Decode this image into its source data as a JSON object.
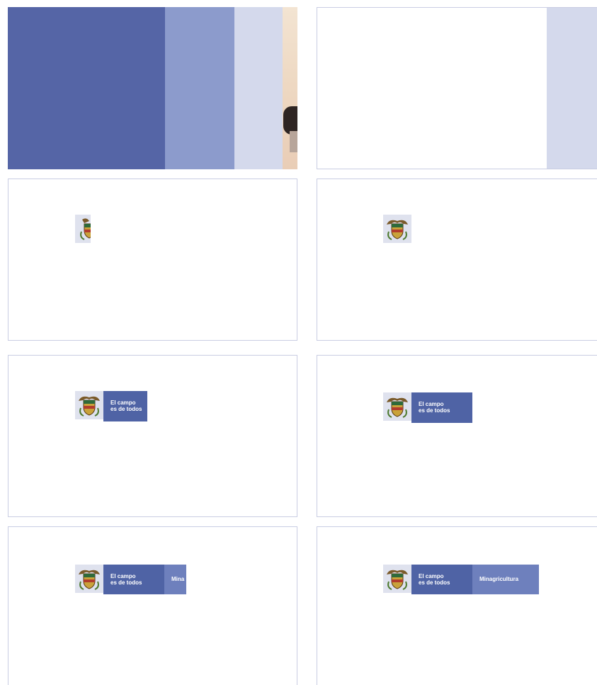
{
  "colors": {
    "dark_blue": "#5565a6",
    "mid_blue": "#8c9bcc",
    "light_blue": "#d4d9ec",
    "pale_blue": "#d4d9ec",
    "brand_blue": "#4f63a5",
    "ministry_blue": "#6e80bd",
    "frame_border": "#c9cde3"
  },
  "frames": [
    {
      "name": "frame-1",
      "stage": "color-bars"
    },
    {
      "name": "frame-2",
      "stage": "white-with-edge-bar"
    },
    {
      "name": "frame-3",
      "stage": "emblem-partial"
    },
    {
      "name": "frame-4",
      "stage": "emblem"
    },
    {
      "name": "frame-5",
      "stage": "emblem-and-slogan-partial"
    },
    {
      "name": "frame-6",
      "stage": "emblem-and-slogan"
    },
    {
      "name": "frame-7",
      "stage": "emblem-slogan-ministry-partial"
    },
    {
      "name": "frame-8",
      "stage": "emblem-slogan-ministry"
    }
  ],
  "logo": {
    "emblem_icon": "colombian-coat-of-arms-icon",
    "slogan_line1": "El campo",
    "slogan_line2": "es de todos",
    "ministry_full": "Minagricultura",
    "ministry_partial": "Mina"
  }
}
